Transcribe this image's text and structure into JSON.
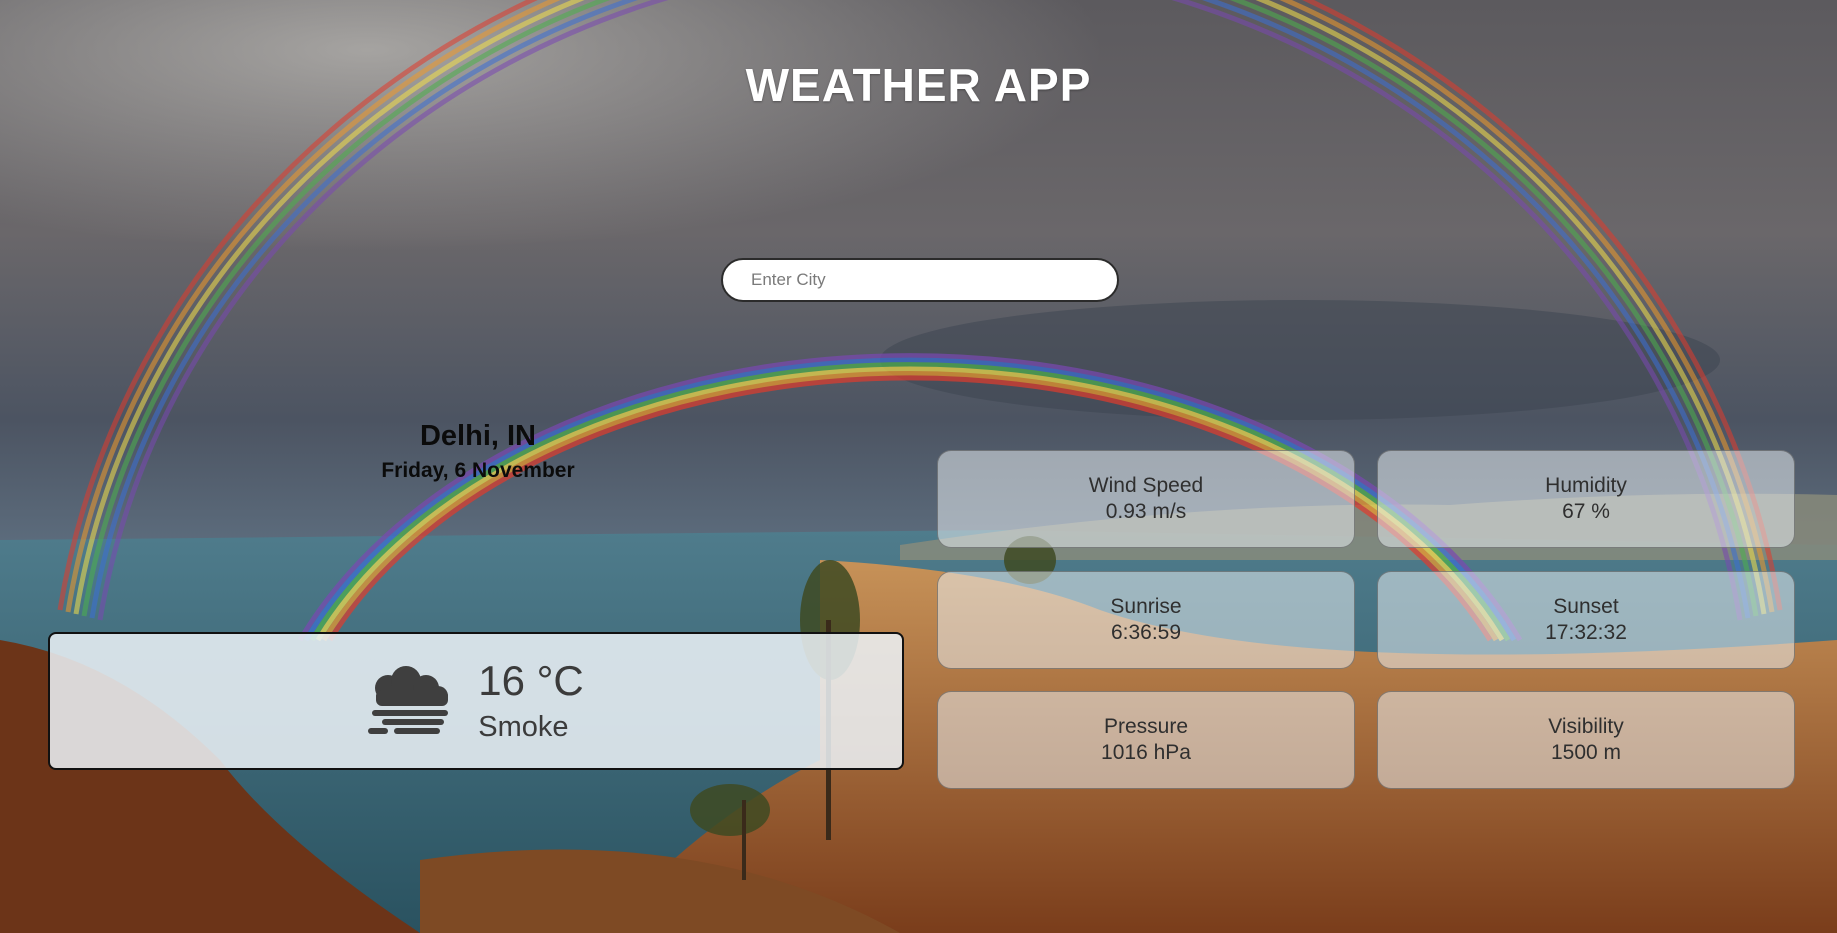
{
  "app": {
    "title": "WEATHER APP"
  },
  "search": {
    "placeholder": "Enter City",
    "value": ""
  },
  "location": {
    "city": "Delhi, IN",
    "date": "Friday, 6 November"
  },
  "current": {
    "icon": "smoke-cloud-icon",
    "temperature": "16 °C",
    "condition": "Smoke"
  },
  "stats": {
    "wind_speed": {
      "label": "Wind Speed",
      "value": "0.93 m/s"
    },
    "humidity": {
      "label": "Humidity",
      "value": "67 %"
    },
    "sunrise": {
      "label": "Sunrise",
      "value": "6:36:59"
    },
    "sunset": {
      "label": "Sunset",
      "value": "17:32:32"
    },
    "pressure": {
      "label": "Pressure",
      "value": "1016 hPa"
    },
    "visibility": {
      "label": "Visibility",
      "value": "1500 m"
    }
  },
  "colors": {
    "title": "#ffffff",
    "card_bg": "#ecf2f7",
    "text_dark": "#3b3b3b"
  }
}
